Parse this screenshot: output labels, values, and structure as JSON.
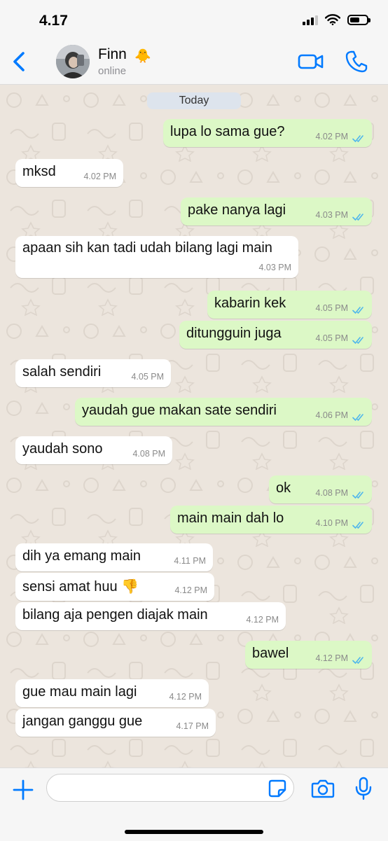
{
  "status_bar": {
    "time": "4.17"
  },
  "header": {
    "contact_name": "Finn",
    "contact_emoji": "🐥",
    "status": "online",
    "icons": [
      "back-chevron-icon",
      "video-call-icon",
      "phone-icon"
    ]
  },
  "chat": {
    "date_label": "Today",
    "messages": [
      {
        "dir": "out",
        "text": "lupa lo sama gue?",
        "time": "4.02 PM",
        "read": true
      },
      {
        "dir": "in",
        "text": "mksd",
        "time": "4.02 PM"
      },
      {
        "dir": "out",
        "text": "pake nanya lagi",
        "time": "4.03 PM",
        "read": true
      },
      {
        "dir": "in",
        "text": "apaan sih kan tadi udah bilang lagi main",
        "time": "4.03 PM"
      },
      {
        "dir": "out",
        "text": "kabarin kek",
        "time": "4.05 PM",
        "read": true
      },
      {
        "dir": "out",
        "text": "ditungguin juga",
        "time": "4.05 PM",
        "read": true
      },
      {
        "dir": "in",
        "text": "salah sendiri",
        "time": "4.05 PM"
      },
      {
        "dir": "out",
        "text": "yaudah gue makan sate sendiri",
        "time": "4.06 PM",
        "read": true
      },
      {
        "dir": "in",
        "text": "yaudah sono",
        "time": "4.08 PM"
      },
      {
        "dir": "out",
        "text": "ok",
        "time": "4.08 PM",
        "read": true
      },
      {
        "dir": "out",
        "text": "main main dah lo",
        "time": "4.10 PM",
        "read": true
      },
      {
        "dir": "in",
        "text": "dih ya emang main",
        "time": "4.11 PM"
      },
      {
        "dir": "in",
        "text": "sensi amat huu 👎",
        "time": "4.12 PM"
      },
      {
        "dir": "in",
        "text": "bilang aja pengen diajak main",
        "time": "4.12 PM"
      },
      {
        "dir": "out",
        "text": "bawel",
        "time": "4.12 PM",
        "read": true
      },
      {
        "dir": "in",
        "text": "gue mau main lagi",
        "time": "4.12 PM"
      },
      {
        "dir": "in",
        "text": "jangan ganggu gue",
        "time": "4.17 PM"
      }
    ]
  },
  "input_bar": {
    "value": "",
    "icons": [
      "plus-icon",
      "sticker-icon",
      "camera-icon",
      "microphone-icon"
    ]
  },
  "colors": {
    "accent": "#007aff",
    "outgoing_bubble": "#dcf8c6",
    "incoming_bubble": "#ffffff",
    "read_tick": "#4fb6ec",
    "wallpaper": "#ece5dd"
  }
}
